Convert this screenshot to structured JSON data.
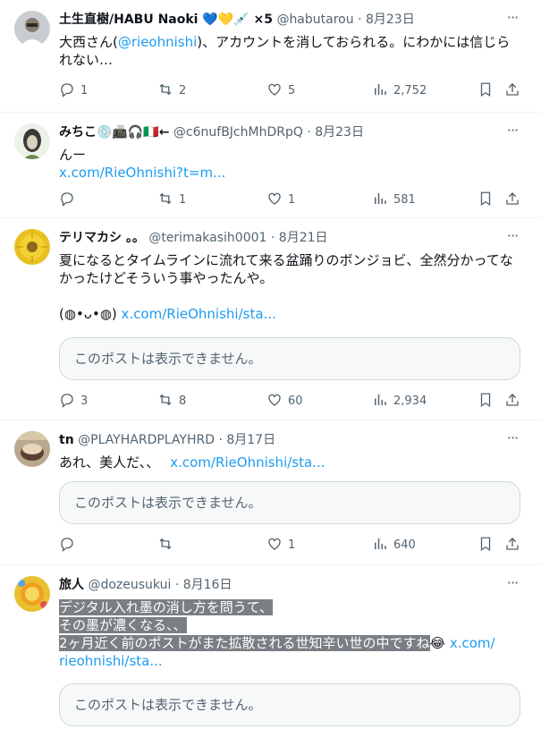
{
  "tweets": [
    {
      "name": "土生直樹/HABU Naoki 💙💛💉 ×5",
      "handle": "@habutarou",
      "time": "8月23日",
      "text": "大西さん(",
      "mention": "@rieohnishi",
      "text_after": ")、アカウントを消しておられる。にわかには信じられない…",
      "replies": "1",
      "retweets": "2",
      "likes": "5",
      "views": "2,752"
    },
    {
      "name": "みちこ💿📠🎧🇮🇹←",
      "handle": "@c6nufBJchMhDRpQ",
      "time": "8月23日",
      "text": "んー",
      "link": "x.com/RieOhnishi?t=m...",
      "replies": "",
      "retweets": "1",
      "likes": "1",
      "views": "581"
    },
    {
      "name": "テリマカシ 。。",
      "handle": "@terimakasih0001",
      "time": "8月21日",
      "text": "夏になるとタイムラインに流れて来る盆踊りのボンジョビ、全然分かってなかったけどそういう事やったんや。",
      "kaomoji": "(◍•ᴗ•◍)",
      "link": "x.com/RieOhnishi/sta...",
      "quote": "このポストは表示できません。",
      "replies": "3",
      "retweets": "8",
      "likes": "60",
      "views": "2,934"
    },
    {
      "name": "tn",
      "handle": "@PLAYHARDPLAYHRD",
      "time": "8月17日",
      "text": "あれ、美人だ、、",
      "link": "x.com/RieOhnishi/sta...",
      "quote": "このポストは表示できません。",
      "replies": "",
      "retweets": "",
      "likes": "1",
      "views": "640"
    },
    {
      "name": "旅人",
      "handle": "@dozeusukui",
      "time": "8月16日",
      "line1": "デジタル入れ墨の消し方を問うて、",
      "line2": "その墨が濃くなる、、",
      "line3": "2ヶ月近く前のポストがまた拡散される世知辛い世の中ですね",
      "emoji": "😂",
      "link_a": "x.com/",
      "link_b": "rieohnishi/sta...",
      "quote": "このポストは表示できません。"
    }
  ],
  "ui": {
    "dot": "·",
    "more": "···"
  },
  "colors": {
    "link": "#1d9bf0",
    "secondary": "#536471",
    "highlight": "#7a7f84"
  }
}
